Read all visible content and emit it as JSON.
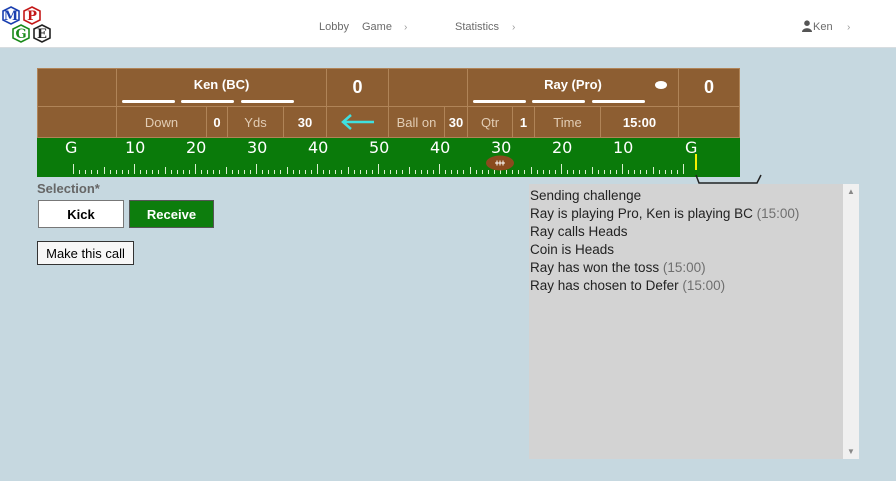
{
  "logo": {
    "letters": [
      "M",
      "P",
      "G",
      "E"
    ]
  },
  "nav": {
    "items": [
      {
        "label": "Lobby"
      },
      {
        "label": "Game"
      },
      {
        "label": "Statistics"
      }
    ],
    "user": "Ken"
  },
  "scoreboard": {
    "home": {
      "name": "Ken (BC)",
      "score": "0",
      "timeouts": 3,
      "possession": false
    },
    "away": {
      "name": "Ray (Pro)",
      "score": "0",
      "timeouts": 3,
      "possession": true
    },
    "down_label": "Down",
    "down": "0",
    "yds_label": "Yds",
    "yds": "30",
    "ball_on_label": "Ball on",
    "ball_on": "30",
    "qtr_label": "Qtr",
    "qtr": "1",
    "time_label": "Time",
    "time": "15:00",
    "direction": "left-arrow"
  },
  "field": {
    "yard_labels": [
      "G",
      "10",
      "20",
      "30",
      "40",
      "50",
      "40",
      "30",
      "20",
      "10",
      "G"
    ],
    "ball_yard": 30,
    "colors": {
      "turf": "#0a7a0a",
      "scoreboard": "#8d5e32",
      "arrow": "#3fe0e0"
    }
  },
  "selection": {
    "label": "Selection*",
    "options": [
      "Kick",
      "Receive"
    ],
    "selected": "Receive",
    "submit_label": "Make this call"
  },
  "log": [
    {
      "text": "Sending challenge",
      "time": ""
    },
    {
      "text": "Ray is playing Pro, Ken is playing BC",
      "time": "(15:00)"
    },
    {
      "text": "Ray calls Heads",
      "time": ""
    },
    {
      "text": "Coin is Heads",
      "time": ""
    },
    {
      "text": "Ray has won the toss",
      "time": "(15:00)"
    },
    {
      "text": "Ray has chosen to Defer",
      "time": "(15:00)"
    }
  ]
}
